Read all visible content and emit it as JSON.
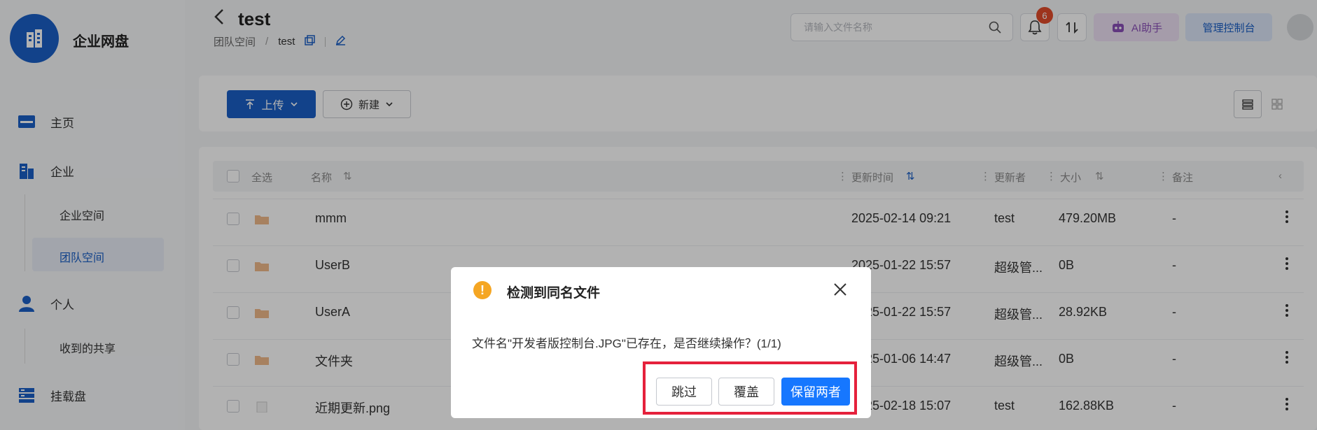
{
  "app": {
    "name": "企业网盘"
  },
  "sidebar": {
    "items": [
      {
        "label": "主页"
      },
      {
        "label": "企业"
      },
      {
        "label": "个人"
      },
      {
        "label": "挂载盘"
      }
    ],
    "subitems": [
      {
        "label": "企业空间"
      },
      {
        "label": "团队空间",
        "active": true
      },
      {
        "label": "收到的共享"
      }
    ]
  },
  "header": {
    "title": "test",
    "breadcrumb": [
      "团队空间",
      "test"
    ],
    "search_placeholder": "请输入文件名称",
    "notification_count": "6",
    "ai_label": "AI助手",
    "admin_label": "管理控制台"
  },
  "toolbar": {
    "upload_label": "上传",
    "new_label": "新建"
  },
  "table": {
    "columns": {
      "select_all": "全选",
      "name": "名称",
      "updated": "更新时间",
      "updater": "更新者",
      "size": "大小",
      "note": "备注"
    },
    "rows": [
      {
        "name": "mmm",
        "time": "2025-02-14 09:21",
        "updater": "test",
        "size": "479.20MB",
        "note": "-"
      },
      {
        "name": "UserB",
        "time": "2025-01-22 15:57",
        "updater": "超级管...",
        "size": "0B",
        "note": "-"
      },
      {
        "name": "UserA",
        "time": "2025-01-22 15:57",
        "updater": "超级管...",
        "size": "28.92KB",
        "note": "-"
      },
      {
        "name": "文件夹",
        "time": "2025-01-06 14:47",
        "updater": "超级管...",
        "size": "0B",
        "note": "-"
      },
      {
        "name": "近期更新.png",
        "time": "2025-02-18 15:07",
        "updater": "test",
        "size": "162.88KB",
        "note": "-"
      }
    ]
  },
  "dialog": {
    "title": "检测到同名文件",
    "message": "文件名\"开发者版控制台.JPG\"已存在，是否继续操作？(1/1)",
    "skip_label": "跳过",
    "overwrite_label": "覆盖",
    "keep_both_label": "保留两者"
  },
  "colors": {
    "brand": "#1a5fc6",
    "primary_button": "#1677ff",
    "warning": "#f5a623",
    "badge": "#e14b2a",
    "highlight_border": "#e5213c"
  }
}
